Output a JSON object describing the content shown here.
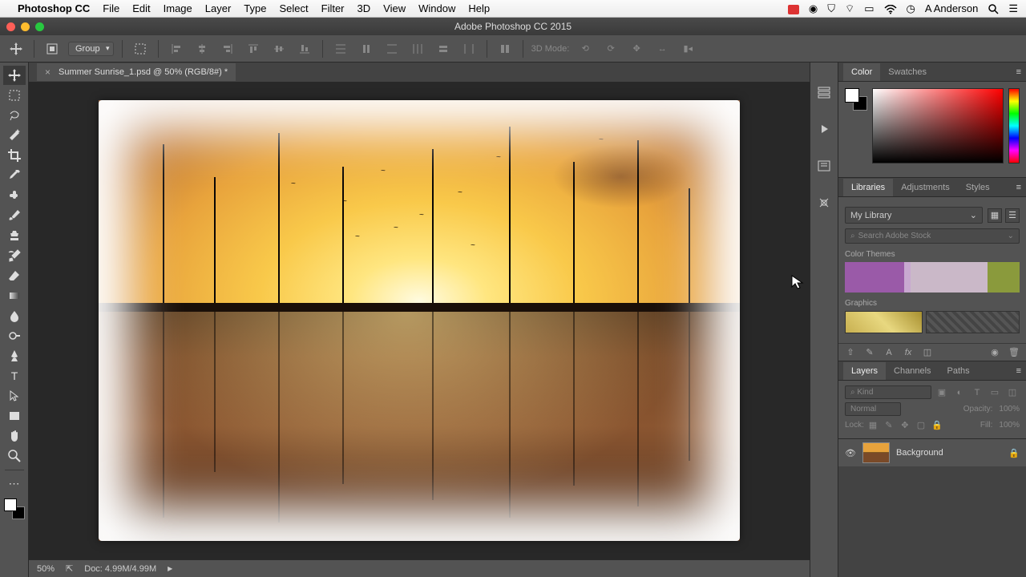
{
  "menubar": {
    "app": "Photoshop CC",
    "items": [
      "File",
      "Edit",
      "Image",
      "Layer",
      "Type",
      "Select",
      "Filter",
      "3D",
      "View",
      "Window",
      "Help"
    ],
    "user": "A Anderson"
  },
  "window": {
    "title": "Adobe Photoshop CC 2015"
  },
  "options": {
    "group_label": "Group",
    "mode_3d": "3D Mode:"
  },
  "document": {
    "tab_title": "Summer Sunrise_1.psd @ 50% (RGB/8#) *",
    "zoom": "50%",
    "doc_info": "Doc: 4.99M/4.99M"
  },
  "panels": {
    "color": {
      "tabs": [
        "Color",
        "Swatches"
      ],
      "active": 0
    },
    "libraries": {
      "tabs": [
        "Libraries",
        "Adjustments",
        "Styles"
      ],
      "active": 0,
      "dropdown": "My Library",
      "search_placeholder": "Search Adobe Stock",
      "section_colors": "Color Themes",
      "section_graphics": "Graphics"
    },
    "layers": {
      "tabs": [
        "Layers",
        "Channels",
        "Paths"
      ],
      "active": 0,
      "kind_label": "Kind",
      "blend_mode": "Normal",
      "opacity_label": "Opacity:",
      "opacity_value": "100%",
      "lock_label": "Lock:",
      "fill_label": "Fill:",
      "fill_value": "100%",
      "items": [
        {
          "name": "Background"
        }
      ]
    }
  },
  "tools": [
    "move",
    "rect-marquee",
    "lasso",
    "magic-wand",
    "crop",
    "eyedropper",
    "spot-heal",
    "brush",
    "clone-stamp",
    "history-brush",
    "eraser",
    "gradient",
    "blur",
    "dodge",
    "pen",
    "type",
    "path-select",
    "rectangle",
    "hand",
    "zoom"
  ]
}
